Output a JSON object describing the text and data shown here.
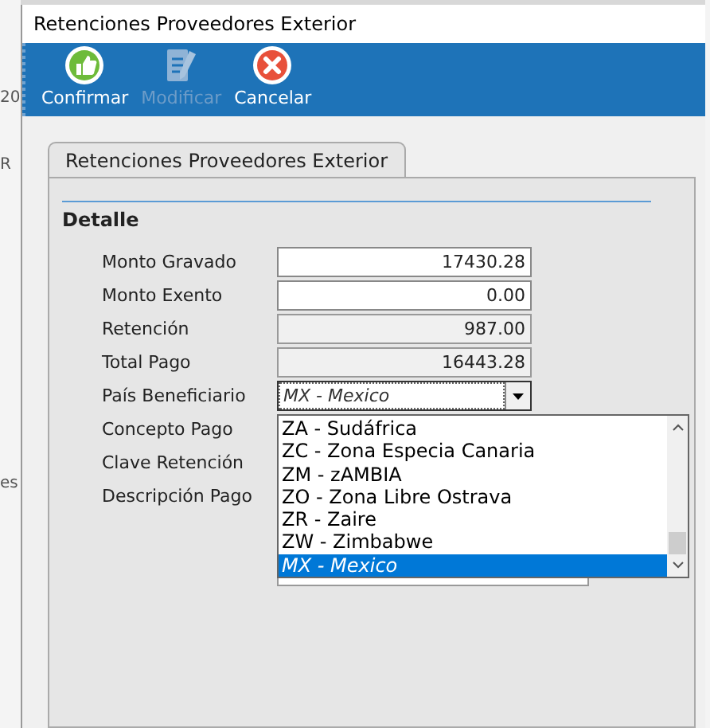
{
  "background": {
    "left_fragments": [
      "20",
      "R",
      "es"
    ]
  },
  "window": {
    "title": "Retenciones Proveedores Exterior"
  },
  "toolbar": {
    "buttons": [
      {
        "label": "Confirmar",
        "kind": "confirm",
        "disabled": false
      },
      {
        "label": "Modificar",
        "kind": "edit",
        "disabled": true
      },
      {
        "label": "Cancelar",
        "kind": "cancel",
        "disabled": false
      }
    ]
  },
  "tabs": [
    {
      "label": "Retenciones Proveedores Exterior",
      "selected": true
    }
  ],
  "section": {
    "title": "Detalle"
  },
  "fields": [
    {
      "label": "Monto Gravado",
      "kind": "input",
      "value": "17430.28",
      "readonly": false
    },
    {
      "label": "Monto Exento",
      "kind": "input",
      "value": "0.00",
      "readonly": false
    },
    {
      "label": "Retención",
      "kind": "input",
      "value": "987.00",
      "readonly": true
    },
    {
      "label": "Total Pago",
      "kind": "input",
      "value": "16443.28",
      "readonly": true
    },
    {
      "label": "País Beneficiario",
      "kind": "combo",
      "value": "MX - Mexico",
      "expanded": true
    },
    {
      "label": "Concepto Pago",
      "kind": "hidden"
    },
    {
      "label": "Clave Retención",
      "kind": "hidden"
    },
    {
      "label": "Descripción Pago",
      "kind": "select"
    }
  ],
  "dropdown": {
    "options": [
      {
        "label": "ZA - Sudáfrica",
        "selected": false
      },
      {
        "label": "ZC - Zona Especia Canaria",
        "selected": false
      },
      {
        "label": "ZM - zAMBIA",
        "selected": false
      },
      {
        "label": "ZO - Zona Libre Ostrava",
        "selected": false
      },
      {
        "label": "ZR - Zaire",
        "selected": false
      },
      {
        "label": "ZW - Zimbabwe",
        "selected": false
      },
      {
        "label": "MX - Mexico",
        "selected": true
      }
    ]
  }
}
